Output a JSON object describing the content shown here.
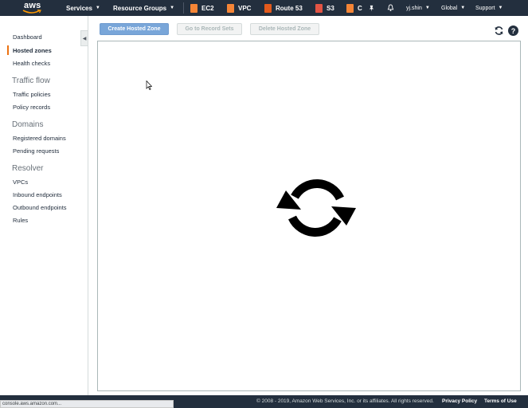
{
  "colors": {
    "nav_bg": "#232f3e",
    "accent": "#ec7211",
    "primary_button": "#79a6d9"
  },
  "topnav": {
    "logo_text": "aws",
    "services_label": "Services",
    "resource_groups_label": "Resource Groups",
    "services": [
      {
        "label": "EC2",
        "icon": "ec2-icon",
        "color": "#f58536"
      },
      {
        "label": "VPC",
        "icon": "vpc-icon",
        "color": "#f58536"
      },
      {
        "label": "Route 53",
        "icon": "route53-icon",
        "color": "#e25a1c"
      },
      {
        "label": "S3",
        "icon": "s3-icon",
        "color": "#e25444"
      },
      {
        "label": "C",
        "icon": "cloudfront-icon",
        "color": "#f58536"
      }
    ],
    "pin_icon": "pin-icon",
    "bell_icon": "bell-icon",
    "user_label": "yj.shin",
    "region_label": "Global",
    "support_label": "Support"
  },
  "sidebar": {
    "collapse_icon": "collapse-left-icon",
    "items": [
      {
        "label": "Dashboard",
        "active": false
      },
      {
        "label": "Hosted zones",
        "active": true
      },
      {
        "label": "Health checks",
        "active": false
      }
    ],
    "traffic_flow": {
      "heading": "Traffic flow",
      "items": [
        "Traffic policies",
        "Policy records"
      ]
    },
    "domains": {
      "heading": "Domains",
      "items": [
        "Registered domains",
        "Pending requests"
      ]
    },
    "resolver": {
      "heading": "Resolver",
      "items": [
        "VPCs",
        "Inbound endpoints",
        "Outbound endpoints",
        "Rules"
      ]
    }
  },
  "toolbar": {
    "create_label": "Create Hosted Zone",
    "goto_label": "Go to Record Sets",
    "delete_label": "Delete Hosted Zone",
    "refresh_icon": "refresh-icon",
    "help_icon": "help-icon",
    "help_glyph": "?"
  },
  "main": {
    "loading_icon": "loading-spinner-icon"
  },
  "footer": {
    "copyright": "© 2008 - 2019, Amazon Web Services, Inc. or its affiliates. All rights reserved.",
    "privacy_label": "Privacy Policy",
    "terms_label": "Terms of Use"
  },
  "status_bar": {
    "url_text": "console.aws.amazon.com..."
  }
}
